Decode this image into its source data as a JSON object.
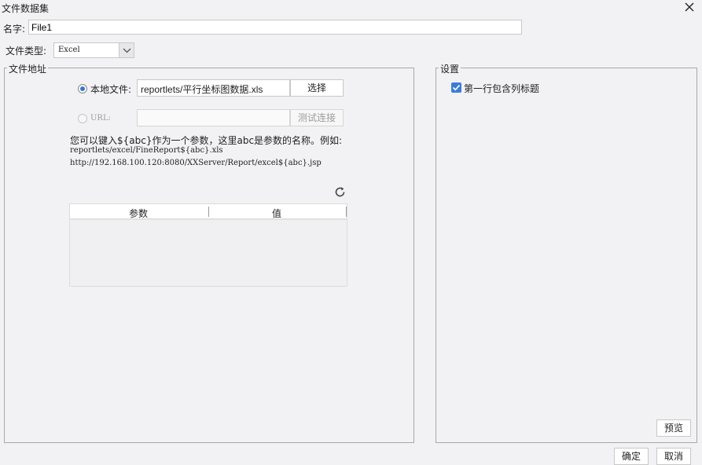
{
  "window": {
    "title": "文件数据集"
  },
  "name": {
    "label": "名字:",
    "value": "File1"
  },
  "file_type": {
    "label": "文件类型:",
    "value": "Excel"
  },
  "file_address": {
    "legend": "文件地址",
    "local": {
      "label": "本地文件:",
      "path": "reportlets/平行坐标图数据.xls",
      "select_button": "选择"
    },
    "url": {
      "label": "URL:",
      "value": "",
      "test_button": "测试连接"
    },
    "hint": "您可以键入${abc}作为一个参数，这里abc是参数的名称。例如:",
    "example1": "reportlets/excel/FineReport${abc}.xls",
    "example2": "http://192.168.100.120:8080/XXServer/Report/excel${abc}.jsp",
    "table": {
      "columns": [
        "参数",
        "值"
      ],
      "rows": []
    }
  },
  "settings": {
    "legend": "设置",
    "first_row_header": {
      "label": "第一行包含列标题",
      "checked": true
    },
    "preview_button": "预览"
  },
  "footer": {
    "ok_button": "确定",
    "cancel_button": "取消"
  },
  "colors": {
    "accent": "#3b7dd8",
    "background": "#f2f2f4",
    "border": "#a8a8a8"
  }
}
